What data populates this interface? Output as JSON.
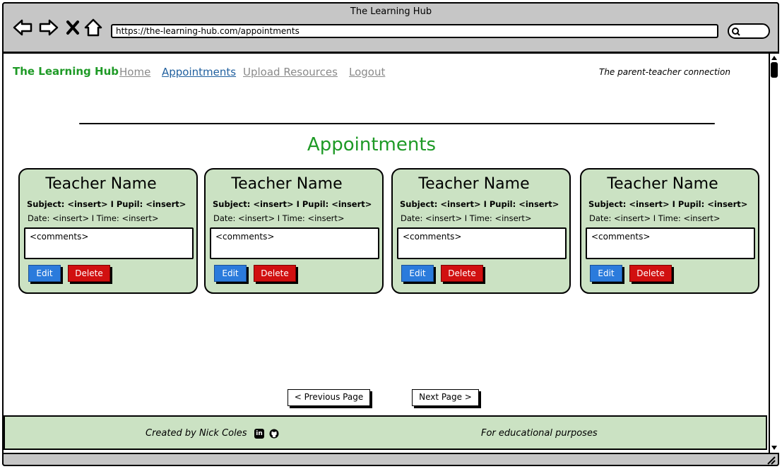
{
  "window": {
    "title": "The Learning Hub",
    "url": "https://the-learning-hub.com/appointments"
  },
  "nav": {
    "brand": "The Learning Hub",
    "links": [
      "Home",
      "Appointments",
      "Upload Resources",
      "Logout"
    ],
    "tagline": "The parent-teacher connection"
  },
  "page": {
    "heading": "Appointments"
  },
  "cards": [
    {
      "title": "Teacher Name",
      "subject": "Subject: <insert> I Pupil: <insert>",
      "date": "Date: <insert> I Time: <insert>",
      "comments": "<comments>",
      "edit": "Edit",
      "delete": "Delete"
    },
    {
      "title": "Teacher Name",
      "subject": "Subject: <insert> I Pupil: <insert>",
      "date": "Date: <insert> I Time: <insert>",
      "comments": "<comments>",
      "edit": "Edit",
      "delete": "Delete"
    },
    {
      "title": "Teacher Name",
      "subject": "Subject: <insert> I Pupil: <insert>",
      "date": "Date: <insert> I Time: <insert>",
      "comments": "<comments>",
      "edit": "Edit",
      "delete": "Delete"
    },
    {
      "title": "Teacher Name",
      "subject": "Subject: <insert> I Pupil: <insert>",
      "date": "Date: <insert> I Time: <insert>",
      "comments": "<comments>",
      "edit": "Edit",
      "delete": "Delete"
    }
  ],
  "pagination": {
    "previous": "< Previous Page",
    "next": "Next Page >"
  },
  "footer": {
    "credit": "Created by Nick Coles",
    "note": "For educational purposes",
    "icons": [
      "linkedin-icon",
      "github-icon"
    ]
  },
  "colors": {
    "brand": "#1e9a26",
    "card": "#cbe2c3",
    "edit": "#2b7bdc",
    "delete": "#d11010",
    "chrome": "#c6c6c6"
  }
}
